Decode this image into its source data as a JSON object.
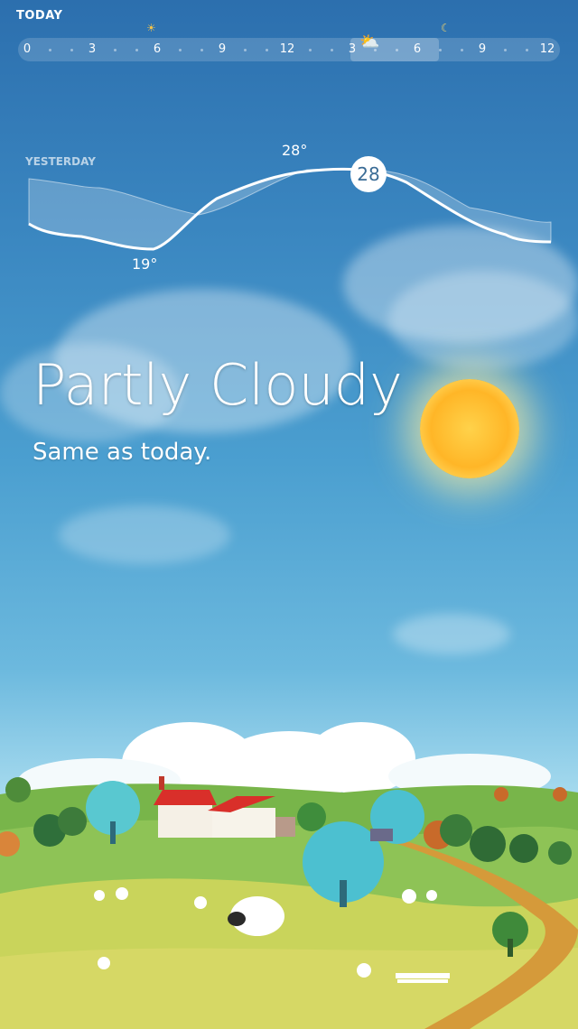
{
  "header": {
    "title": "TODAY"
  },
  "timeline": {
    "ticks": [
      "0",
      "3",
      "6",
      "9",
      "12",
      "3",
      "6",
      "9",
      "12"
    ],
    "icons": [
      "sunrise-icon",
      "partly-cloudy-icon",
      "moon-icon"
    ]
  },
  "graph": {
    "yesterday_label": "YESTERDAY",
    "high_label": "28°",
    "low_label": "19°",
    "current_temp": "28"
  },
  "weather": {
    "condition": "Partly Cloudy",
    "comparison": "Same as today."
  },
  "colors": {
    "sky_top": "#2c6fae",
    "sky_bottom": "#e7f4f9",
    "badge_text": "#3a6c96",
    "sun": "#ffb627"
  }
}
